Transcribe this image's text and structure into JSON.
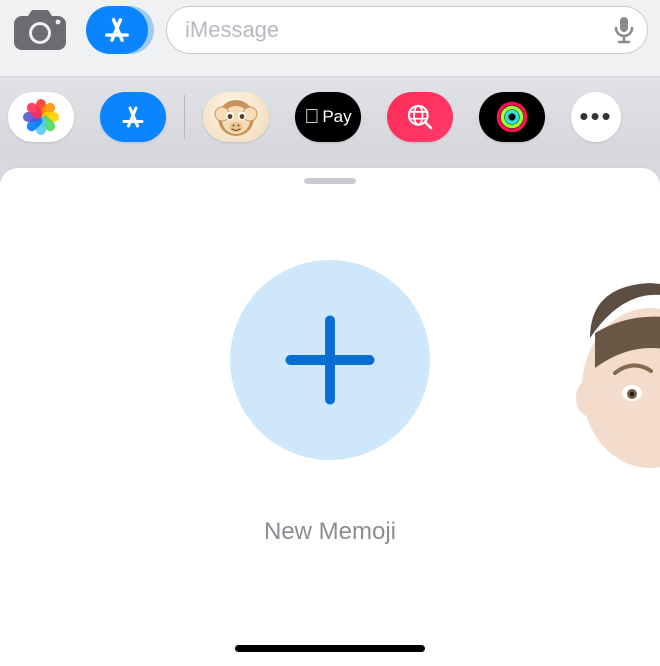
{
  "compose": {
    "placeholder": "iMessage",
    "value": ""
  },
  "toolbar": {
    "camera": "camera",
    "store_toggle": "app-drawer-toggle"
  },
  "apps": [
    {
      "name": "Photos",
      "kind": "photos"
    },
    {
      "name": "App Store",
      "kind": "store"
    },
    {
      "name": "Memoji",
      "kind": "memoji"
    },
    {
      "name": "Apple Pay",
      "kind": "applepay",
      "label_prefix": "",
      "label": "Pay"
    },
    {
      "name": "#images",
      "kind": "globe"
    },
    {
      "name": "Activity",
      "kind": "activity"
    },
    {
      "name": "More",
      "kind": "more",
      "label": "•••"
    }
  ],
  "memoji_panel": {
    "new_label": "New Memoji"
  },
  "colors": {
    "accent": "#0a84ff",
    "plus_circle": "#cfe7fb",
    "plus_stroke": "#0a6dd6"
  }
}
